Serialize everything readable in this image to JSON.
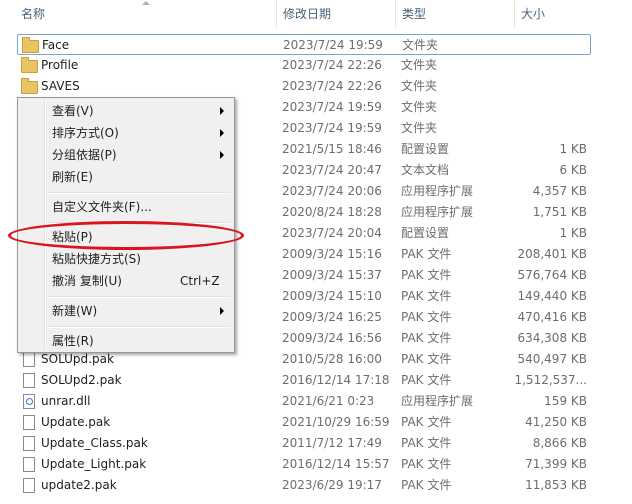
{
  "header": {
    "name": "名称",
    "date": "修改日期",
    "type": "类型",
    "size": "大小"
  },
  "rows": [
    {
      "icon": "folder",
      "name": "Face",
      "date": "2023/7/24 19:59",
      "type": "文件夹",
      "size": ""
    },
    {
      "icon": "folder",
      "name": "Profile",
      "date": "2023/7/24 22:26",
      "type": "文件夹",
      "size": ""
    },
    {
      "icon": "folder",
      "name": "SAVES",
      "date": "2023/7/24 22:26",
      "type": "文件夹",
      "size": ""
    },
    {
      "icon": "folder",
      "name": "",
      "date": "2023/7/24 19:59",
      "type": "文件夹",
      "size": ""
    },
    {
      "icon": "folder",
      "name": "",
      "date": "2023/7/24 19:59",
      "type": "文件夹",
      "size": ""
    },
    {
      "icon": "file",
      "name": "",
      "date": "2021/5/15 18:46",
      "type": "配置设置",
      "size": "1 KB"
    },
    {
      "icon": "file",
      "name": "",
      "date": "2023/7/24 20:47",
      "type": "文本文档",
      "size": "6 KB"
    },
    {
      "icon": "file",
      "name": "",
      "date": "2023/7/24 20:06",
      "type": "应用程序扩展",
      "size": "4,357 KB"
    },
    {
      "icon": "file",
      "name": "",
      "date": "2020/8/24 18:28",
      "type": "应用程序扩展",
      "size": "1,751 KB"
    },
    {
      "icon": "file",
      "name": "",
      "date": "2023/7/24 20:04",
      "type": "配置设置",
      "size": "1 KB"
    },
    {
      "icon": "file",
      "name": "",
      "date": "2009/3/24 15:16",
      "type": "PAK 文件",
      "size": "208,401 KB"
    },
    {
      "icon": "file",
      "name": "",
      "date": "2009/3/24 15:37",
      "type": "PAK 文件",
      "size": "576,764 KB"
    },
    {
      "icon": "file",
      "name": "",
      "date": "2009/3/24 15:10",
      "type": "PAK 文件",
      "size": "149,440 KB"
    },
    {
      "icon": "file",
      "name": "",
      "date": "2009/3/24 16:25",
      "type": "PAK 文件",
      "size": "470,416 KB"
    },
    {
      "icon": "file",
      "name": "",
      "date": "2009/3/24 16:56",
      "type": "PAK 文件",
      "size": "634,308 KB"
    },
    {
      "icon": "file",
      "name": "SOLUpd.pak",
      "date": "2010/5/28 16:00",
      "type": "PAK 文件",
      "size": "540,497 KB"
    },
    {
      "icon": "file",
      "name": "SOLUpd2.pak",
      "date": "2016/12/14 17:18",
      "type": "PAK 文件",
      "size": "1,512,537..."
    },
    {
      "icon": "dll",
      "name": "unrar.dll",
      "date": "2021/6/21 0:23",
      "type": "应用程序扩展",
      "size": "159 KB"
    },
    {
      "icon": "file",
      "name": "Update.pak",
      "date": "2021/10/29 16:59",
      "type": "PAK 文件",
      "size": "41,250 KB"
    },
    {
      "icon": "file",
      "name": "Update_Class.pak",
      "date": "2011/7/12 17:49",
      "type": "PAK 文件",
      "size": "8,866 KB"
    },
    {
      "icon": "file",
      "name": "Update_Light.pak",
      "date": "2016/12/14 15:57",
      "type": "PAK 文件",
      "size": "71,399 KB"
    },
    {
      "icon": "file",
      "name": "update2.pak",
      "date": "2023/6/29 19:17",
      "type": "PAK 文件",
      "size": "11,853 KB"
    }
  ],
  "context_menu": {
    "items": [
      {
        "label": "查看(V)",
        "shortcut": "",
        "submenu": true
      },
      {
        "label": "排序方式(O)",
        "shortcut": "",
        "submenu": true
      },
      {
        "label": "分组依据(P)",
        "shortcut": "",
        "submenu": true
      },
      {
        "label": "刷新(E)",
        "shortcut": "",
        "submenu": false
      },
      {
        "separator": true
      },
      {
        "label": "自定义文件夹(F)...",
        "shortcut": "",
        "submenu": false
      },
      {
        "separator": true
      },
      {
        "label": "粘贴(P)",
        "shortcut": "",
        "submenu": false
      },
      {
        "label": "粘贴快捷方式(S)",
        "shortcut": "",
        "submenu": false
      },
      {
        "label": "撤消 复制(U)",
        "shortcut": "Ctrl+Z",
        "submenu": false
      },
      {
        "separator": true
      },
      {
        "label": "新建(W)",
        "shortcut": "",
        "submenu": true
      },
      {
        "separator": true
      },
      {
        "label": "属性(R)",
        "shortcut": "",
        "submenu": false
      }
    ]
  },
  "colors": {
    "annotation": "#d9161f",
    "selection_border": "#7da2ce",
    "header_text": "#4c607a"
  }
}
